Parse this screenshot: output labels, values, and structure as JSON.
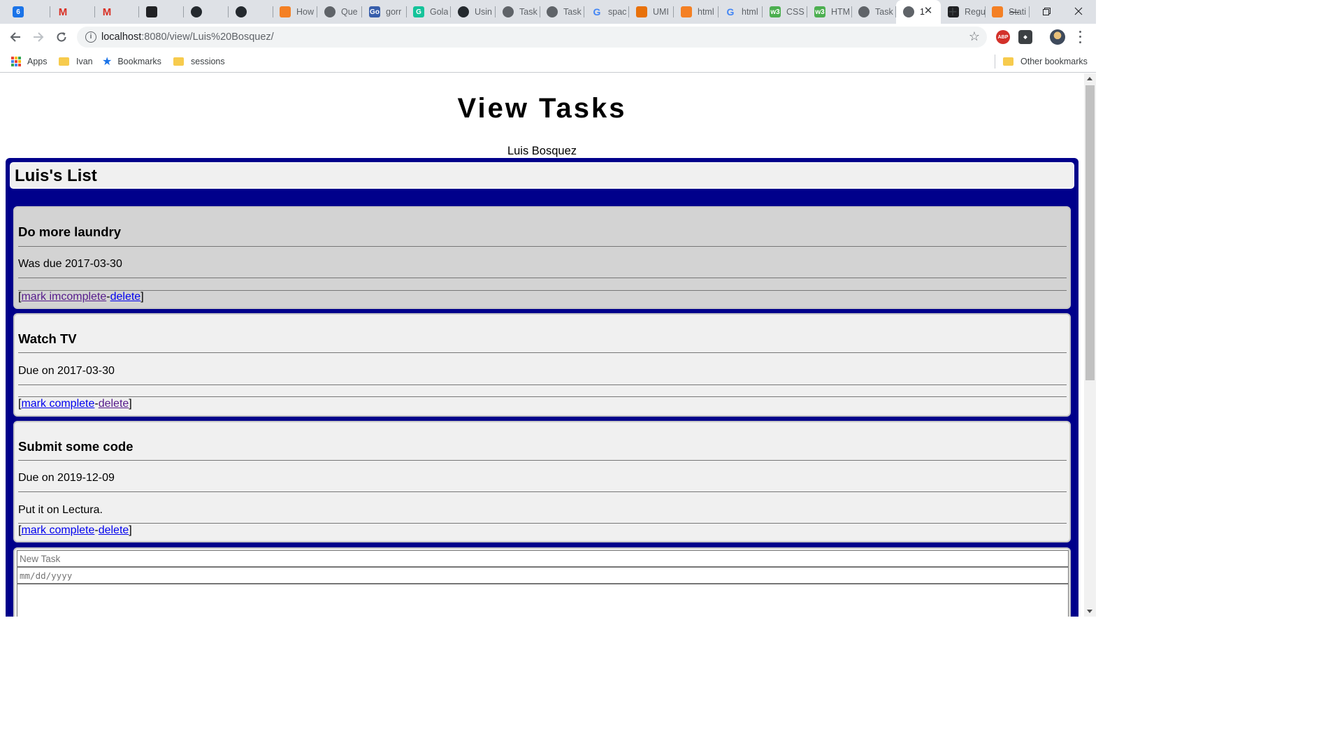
{
  "browser": {
    "tabs": [
      {
        "title": "",
        "icon": "calendar-icon",
        "color": "#1a73e8",
        "glyph": "6"
      },
      {
        "title": "",
        "icon": "gmail-icon",
        "color": "#ffffff",
        "glyph": "M"
      },
      {
        "title": "",
        "icon": "gmail-icon",
        "color": "#ffffff",
        "glyph": "M"
      },
      {
        "title": "",
        "icon": "slides-icon",
        "color": "#202124",
        "glyph": ""
      },
      {
        "title": "",
        "icon": "github-icon",
        "color": "#24292e",
        "glyph": ""
      },
      {
        "title": "",
        "icon": "github-icon",
        "color": "#24292e",
        "glyph": ""
      },
      {
        "title": "How",
        "icon": "stackoverflow-icon",
        "color": "#f48024",
        "glyph": ""
      },
      {
        "title": "Que",
        "icon": "globe-icon",
        "color": "#5f6368",
        "glyph": ""
      },
      {
        "title": "gorr",
        "icon": "godoc-icon",
        "color": "#375eab",
        "glyph": "Go"
      },
      {
        "title": "Gola",
        "icon": "grammarly-icon",
        "color": "#15c39a",
        "glyph": "G"
      },
      {
        "title": "Usin",
        "icon": "github-icon",
        "color": "#24292e",
        "glyph": ""
      },
      {
        "title": "Task",
        "icon": "globe-icon",
        "color": "#5f6368",
        "glyph": ""
      },
      {
        "title": "Task",
        "icon": "globe-icon",
        "color": "#5f6368",
        "glyph": ""
      },
      {
        "title": "spac",
        "icon": "google-icon",
        "color": "#4285f4",
        "glyph": "G"
      },
      {
        "title": "UMI",
        "icon": "uml-icon",
        "color": "#e8710a",
        "glyph": ""
      },
      {
        "title": "html",
        "icon": "stackoverflow-icon",
        "color": "#f48024",
        "glyph": ""
      },
      {
        "title": "html",
        "icon": "google-icon",
        "color": "#4285f4",
        "glyph": "G"
      },
      {
        "title": "CSS",
        "icon": "w3schools-icon",
        "color": "#4caf50",
        "glyph": "w3"
      },
      {
        "title": "HTM",
        "icon": "w3schools-icon",
        "color": "#4caf50",
        "glyph": "w3"
      },
      {
        "title": "Task",
        "icon": "globe-icon",
        "color": "#5f6368",
        "glyph": ""
      },
      {
        "title": "1",
        "icon": "globe-icon",
        "color": "#5f6368",
        "glyph": "",
        "active": true
      },
      {
        "title": "Regu",
        "icon": "regex-icon",
        "color": "#202124",
        "glyph": ""
      },
      {
        "title": "Stati",
        "icon": "stackoverflow-icon",
        "color": "#f48024",
        "glyph": ""
      }
    ],
    "url_host": "localhost",
    "url_path": ":8080/view/Luis%20Bosquez/",
    "bookmarks": {
      "apps": "Apps",
      "ivan": "Ivan",
      "bookmarks": "Bookmarks",
      "sessions": "sessions",
      "other": "Other bookmarks"
    },
    "extensions": {
      "abp": "ABP"
    }
  },
  "page": {
    "title": "View Tasks",
    "username": "Luis Bosquez",
    "list_title": "Luis's List",
    "tasks": [
      {
        "title": "Do more laundry",
        "due": "Was due 2017-03-30",
        "description": "",
        "toggle_label": "mark imcomplete",
        "delete_label": "delete",
        "completed": true
      },
      {
        "title": "Watch TV",
        "due": "Due on 2017-03-30",
        "description": "",
        "toggle_label": "mark complete",
        "delete_label": "delete",
        "completed": false
      },
      {
        "title": "Submit some code",
        "due": "Due on 2019-12-09",
        "description": "Put it on Lectura.",
        "toggle_label": "mark complete",
        "delete_label": "delete",
        "completed": false
      }
    ],
    "new_task": {
      "title_placeholder": "New Task",
      "date_placeholder": "mm/dd/yyyy"
    },
    "colors": {
      "list_panel": "#00008b",
      "completed_task": "#d3d3d3",
      "open_task": "#f0f0f0"
    }
  }
}
